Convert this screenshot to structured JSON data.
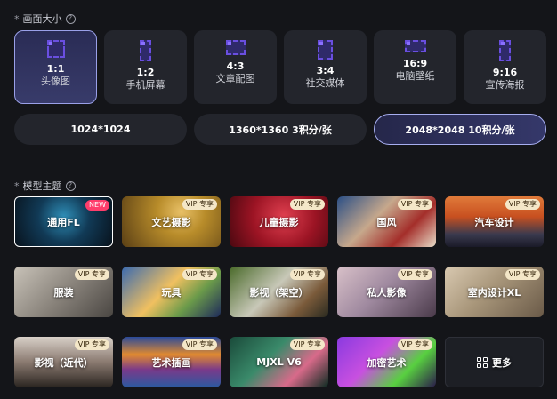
{
  "size_section": {
    "title": "画面大小",
    "help": "?"
  },
  "ratios": [
    {
      "label": "1:1",
      "sub": "头像图",
      "active": true
    },
    {
      "label": "1:2",
      "sub": "手机屏幕",
      "active": false
    },
    {
      "label": "4:3",
      "sub": "文章配图",
      "active": false
    },
    {
      "label": "3:4",
      "sub": "社交媒体",
      "active": false
    },
    {
      "label": "16:9",
      "sub": "电脑壁纸",
      "active": false
    },
    {
      "label": "9:16",
      "sub": "宣传海报",
      "active": false
    }
  ],
  "sizes": [
    {
      "label": "1024*1024",
      "active": false
    },
    {
      "label": "1360*1360 3积分/张",
      "active": false
    },
    {
      "label": "2048*2048 10积分/张",
      "active": true
    }
  ],
  "model_section": {
    "title": "模型主题",
    "help": "?"
  },
  "models": [
    {
      "name": "通用FL",
      "badge": "NEW",
      "active": true
    },
    {
      "name": "文艺摄影",
      "badge": "VIP 专享"
    },
    {
      "name": "儿童摄影",
      "badge": "VIP 专享"
    },
    {
      "name": "国风",
      "badge": "VIP 专享"
    },
    {
      "name": "汽车设计",
      "badge": "VIP 专享"
    },
    {
      "name": "服装",
      "badge": "VIP 专享"
    },
    {
      "name": "玩具",
      "badge": "VIP 专享"
    },
    {
      "name": "影视（架空）",
      "badge": "VIP 专享"
    },
    {
      "name": "私人影像",
      "badge": "VIP 专享"
    },
    {
      "name": "室内设计XL",
      "badge": "VIP 专享"
    },
    {
      "name": "影视（近代）",
      "badge": "VIP 专享"
    },
    {
      "name": "艺术插画",
      "badge": "VIP 专享"
    },
    {
      "name": "MJXL V6",
      "badge": "VIP 专享"
    },
    {
      "name": "加密艺术",
      "badge": "VIP 专享"
    }
  ],
  "more_button": {
    "label": "更多",
    "icon": "grid-icon"
  },
  "colors": {
    "accent": "#6a4fe0",
    "active_border": "#9aa0e8",
    "badge_vip": "#f4e7c8",
    "badge_new": "#ff3d6b"
  }
}
